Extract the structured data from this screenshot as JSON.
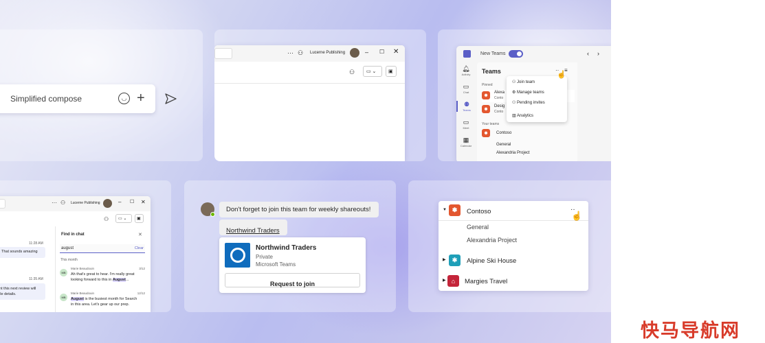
{
  "compose": {
    "placeholder": "Simplified compose"
  },
  "top_window": {
    "org": "Lucerne Publishing"
  },
  "teams_panel": {
    "toggle_label": "New Teams",
    "title": "Teams",
    "pinned_label": "Pinned",
    "pinned": [
      {
        "name": "Alexa",
        "sub": "Conto"
      },
      {
        "name": "Desig",
        "sub": "Conto"
      }
    ],
    "your_teams_label": "Your teams",
    "teams": [
      "Contoso",
      "General",
      "Alexandria Project"
    ],
    "rail": [
      "Activity",
      "Chat",
      "Teams",
      "Meet",
      "Calendar"
    ],
    "menu": [
      "Join team",
      "Manage teams",
      "Pending invites",
      "Analytics"
    ]
  },
  "chat_window": {
    "org": "Lucerne Publishing",
    "find_title": "Find in chat",
    "search_value": "august",
    "clear": "Clear",
    "this_month": "This month",
    "times": [
      "11:28 AM",
      "11:35 AM"
    ],
    "bubbles": [
      "That sounds amazing",
      "ent this next review will",
      "ible details."
    ],
    "results": [
      {
        "initials": "MB",
        "author": "Marie Beaudouin",
        "date": "3/12",
        "line1": "Ah that's great to hear. I'm really great",
        "line2_pre": "looking forward to this in ",
        "line2_hl": "August",
        "line2_post": "..."
      },
      {
        "initials": "MB",
        "author": "Marie Beaudouin",
        "date": "12/12",
        "line1_hl": "August",
        "line1_post": " is the busiest month for Search",
        "line2": "in this area. Let's gear up our prep."
      }
    ]
  },
  "invite": {
    "message": "Don't forget to join this team for weekly shareouts!",
    "link": "Northwind Traders",
    "card_title": "Northwind Traders",
    "card_privacy": "Private",
    "card_app": "Microsoft Teams",
    "button": "Request to join"
  },
  "team_list": {
    "items": [
      {
        "name": "Contoso",
        "children": [
          "General",
          "Alexandria Project"
        ],
        "color": "#e3572f"
      },
      {
        "name": "Alpine Ski House",
        "color": "#1f9fb8"
      },
      {
        "name": "Margies Travel",
        "color": "#c4253a"
      }
    ]
  },
  "watermark": "快马导航网"
}
